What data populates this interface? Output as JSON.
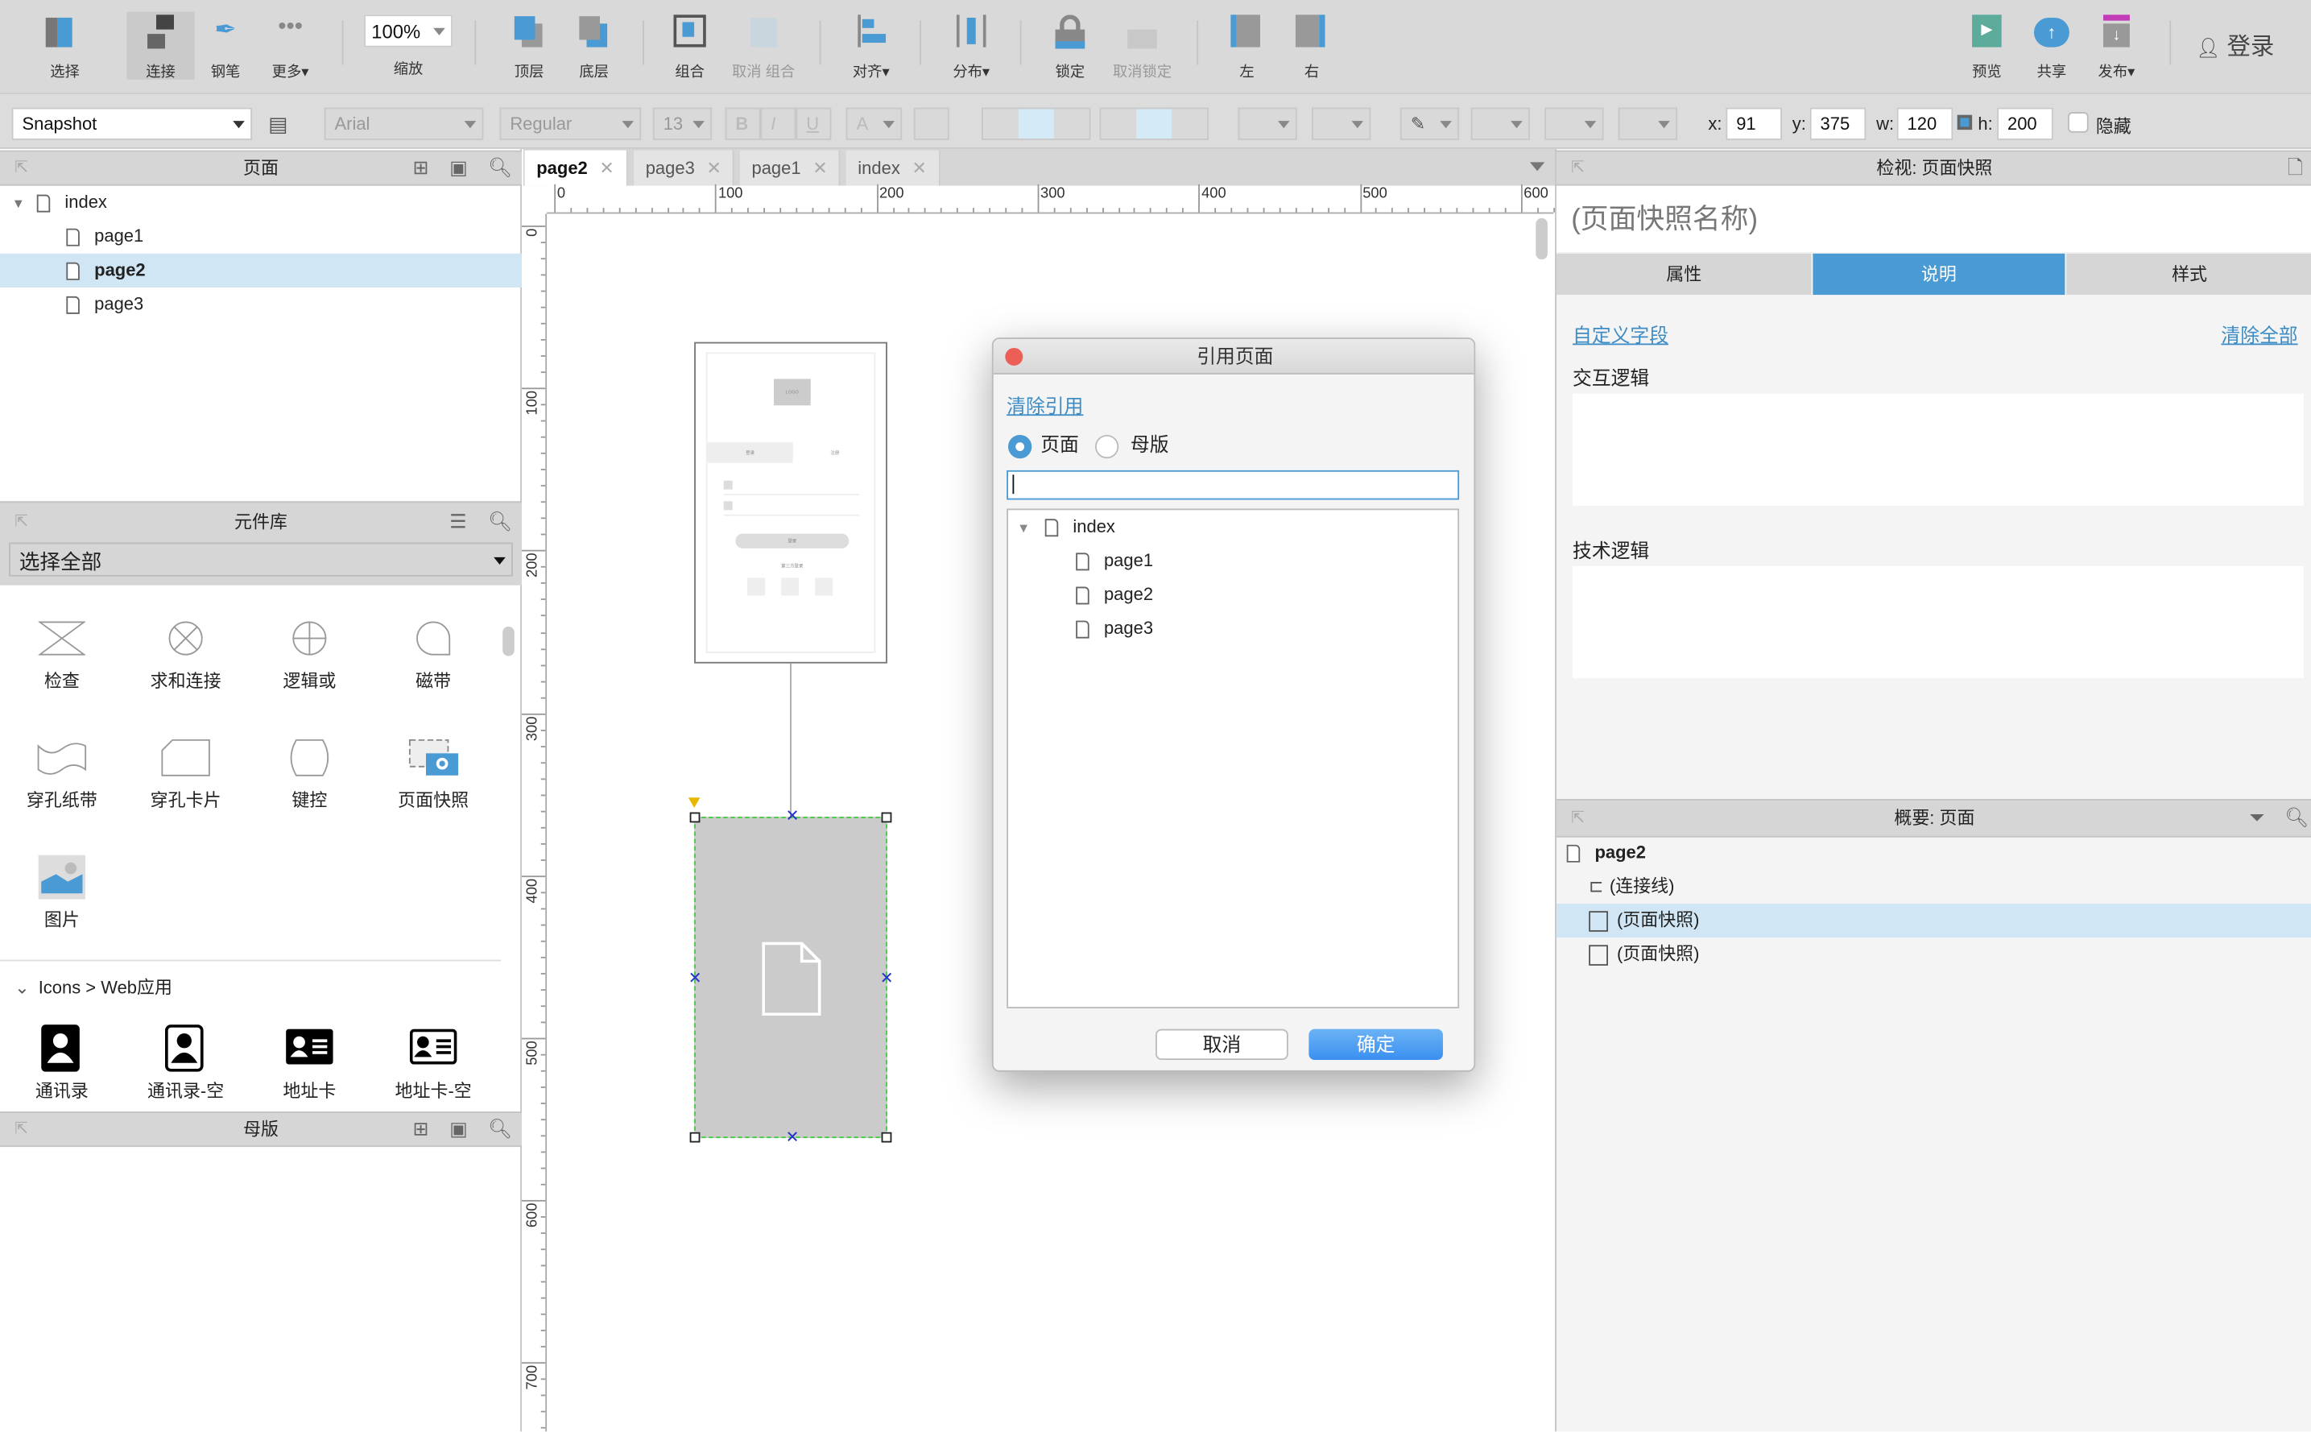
{
  "toolbar": {
    "tools": [
      {
        "label": "选择",
        "icon": "select-icon"
      },
      {
        "label": "连接",
        "icon": "connect-icon"
      },
      {
        "label": "钢笔",
        "icon": "pen-icon"
      },
      {
        "label": "更多▾",
        "icon": "more-icon"
      },
      {
        "label": "缩放",
        "icon": "zoom-icon"
      },
      {
        "label": "顶层",
        "icon": "bring-front-icon"
      },
      {
        "label": "底层",
        "icon": "send-back-icon"
      },
      {
        "label": "组合",
        "icon": "group-icon"
      },
      {
        "label": "取消 组合",
        "icon": "ungroup-icon"
      },
      {
        "label": "对齐▾",
        "icon": "align-icon"
      },
      {
        "label": "分布▾",
        "icon": "distribute-icon"
      },
      {
        "label": "锁定",
        "icon": "lock-icon"
      },
      {
        "label": "取消锁定",
        "icon": "unlock-icon"
      },
      {
        "label": "左",
        "icon": "left-icon"
      },
      {
        "label": "右",
        "icon": "right-icon"
      },
      {
        "label": "预览",
        "icon": "preview-icon"
      },
      {
        "label": "共享",
        "icon": "share-icon"
      },
      {
        "label": "发布▾",
        "icon": "publish-icon"
      }
    ],
    "zoom_value": "100%",
    "login": "登录"
  },
  "format": {
    "style": "Snapshot",
    "font": "Arial",
    "weight": "Regular",
    "size": "13",
    "bold": "B",
    "italic": "I",
    "underline": "U",
    "font_color": "A",
    "x_label": "x:",
    "x": "91",
    "y_label": "y:",
    "y": "375",
    "w_label": "w:",
    "w": "120",
    "h_label": "h:",
    "h": "200",
    "hidden": "隐藏"
  },
  "pages_panel": {
    "title": "页面",
    "items": [
      {
        "label": "index"
      },
      {
        "label": "page1"
      },
      {
        "label": "page2"
      },
      {
        "label": "page3"
      }
    ]
  },
  "library_panel": {
    "title": "元件库",
    "select": "选择全部",
    "widgets": [
      "检查",
      "求和连接",
      "逻辑或",
      "磁带",
      "穿孔纸带",
      "穿孔卡片",
      "键控",
      "页面快照",
      "图片"
    ],
    "section": "Icons > Web应用",
    "icons": [
      "通讯录",
      "通讯录-空",
      "地址卡",
      "地址卡-空"
    ]
  },
  "masters_panel": {
    "title": "母版"
  },
  "tabs": [
    {
      "label": "page2"
    },
    {
      "label": "page3"
    },
    {
      "label": "page1"
    },
    {
      "label": "index"
    }
  ],
  "ruler": {
    "h": [
      "0",
      "100",
      "200",
      "300",
      "400",
      "500",
      "600"
    ],
    "v": [
      "0",
      "100",
      "200",
      "300",
      "400",
      "500",
      "600",
      "700"
    ]
  },
  "thumbnail": {
    "logo": "LOGO",
    "tab1": "登录",
    "tab2": "注册",
    "button": "登录",
    "third": "第三方登录"
  },
  "dialog": {
    "title": "引用页面",
    "clear": "清除引用",
    "radio_page": "页面",
    "radio_master": "母版",
    "selected": "页面",
    "search_value": "",
    "tree": [
      {
        "label": "index"
      },
      {
        "label": "page1"
      },
      {
        "label": "page2"
      },
      {
        "label": "page3"
      }
    ],
    "cancel": "取消",
    "ok": "确定"
  },
  "inspector": {
    "title": "检视: 页面快照",
    "name_placeholder": "(页面快照名称)",
    "tabs": [
      "属性",
      "说明",
      "样式"
    ],
    "active_tab": "说明",
    "custom_fields": "自定义字段",
    "clear_all": "清除全部",
    "field1": "交互逻辑",
    "field2": "技术逻辑"
  },
  "outline": {
    "title": "概要: 页面",
    "root": "page2",
    "items": [
      {
        "label": "(连接线)"
      },
      {
        "label": "(页面快照)"
      },
      {
        "label": "(页面快照)"
      }
    ]
  },
  "colors": {
    "accent": "#4a9ad4",
    "selection": "#d0e6f4",
    "close": "#ec5f57"
  }
}
